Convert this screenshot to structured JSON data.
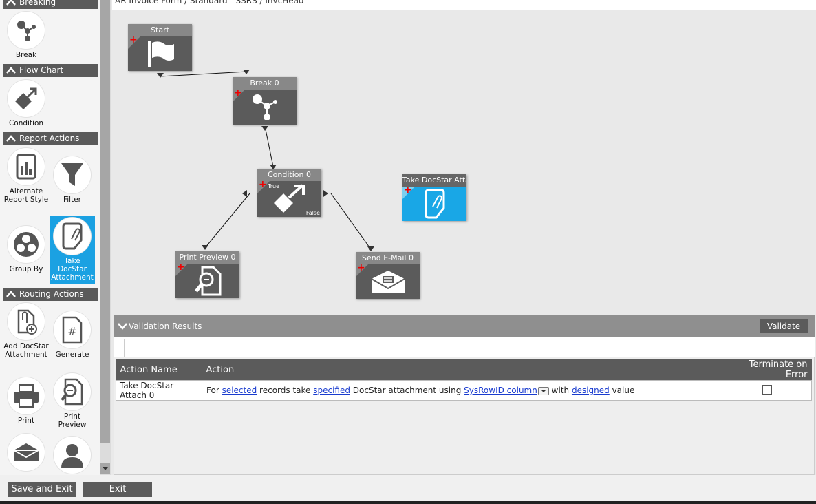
{
  "breadcrumb": "AR Invoice Form / Standard - SSRS / InvcHead",
  "toolbox": {
    "categories": [
      {
        "name": "Breaking",
        "tools": [
          {
            "label": "Break",
            "icon": "break-icon"
          }
        ]
      },
      {
        "name": "Flow Chart",
        "tools": [
          {
            "label": "Condition",
            "icon": "condition-icon"
          }
        ]
      },
      {
        "name": "Report Actions",
        "tools": [
          {
            "label": "Alternate Report Style",
            "icon": "report-style-icon"
          },
          {
            "label": "Filter",
            "icon": "filter-icon"
          },
          {
            "label": "Group By",
            "icon": "group-by-icon"
          },
          {
            "label": "Take DocStar Attachment",
            "icon": "take-attachment-icon",
            "selected": true
          }
        ]
      },
      {
        "name": "Routing Actions",
        "tools": [
          {
            "label": "Add DocStar Attachment",
            "icon": "add-attachment-icon"
          },
          {
            "label": "Generate",
            "icon": "generate-icon"
          },
          {
            "label": "Print",
            "icon": "printer-icon"
          },
          {
            "label": "Print Preview",
            "icon": "print-preview-icon"
          },
          {
            "label": "",
            "icon": "email-icon"
          },
          {
            "label": "",
            "icon": "person-icon"
          }
        ]
      }
    ]
  },
  "nodes": {
    "start": {
      "title": "Start",
      "icon": "flag-icon"
    },
    "break0": {
      "title": "Break 0",
      "icon": "break-icon"
    },
    "condition0": {
      "title": "Condition 0",
      "icon": "condition-icon",
      "true_label": "True",
      "false_label": "False"
    },
    "print_preview0": {
      "title": "Print Preview 0",
      "icon": "print-preview-icon"
    },
    "send_email0": {
      "title": "Send E-Mail 0",
      "icon": "email-icon"
    },
    "take_docstar": {
      "title": "Take DocStar Attac",
      "icon": "take-attachment-icon",
      "color": "#19a7e6"
    }
  },
  "validation": {
    "header": "Validation Results",
    "validate_label": "Validate",
    "columns": [
      "Action Name",
      "Action",
      "Terminate on Error"
    ],
    "rows": [
      {
        "action_name": "Take DocStar Attach 0",
        "text_1": "For ",
        "link_1": "selected",
        "text_2": " records take ",
        "link_2": "specified",
        "text_3": " DocStar attachment using ",
        "link_3": "SysRowID column",
        "text_4": " with ",
        "link_4": "designed",
        "text_5": " value",
        "terminate_on_error": false
      }
    ]
  },
  "footer": {
    "save_exit_label": "Save and Exit",
    "exit_label": "Exit"
  },
  "colors": {
    "accent": "#1ba1e2",
    "node": "#5b5b5b",
    "header": "#5a5a5a"
  }
}
